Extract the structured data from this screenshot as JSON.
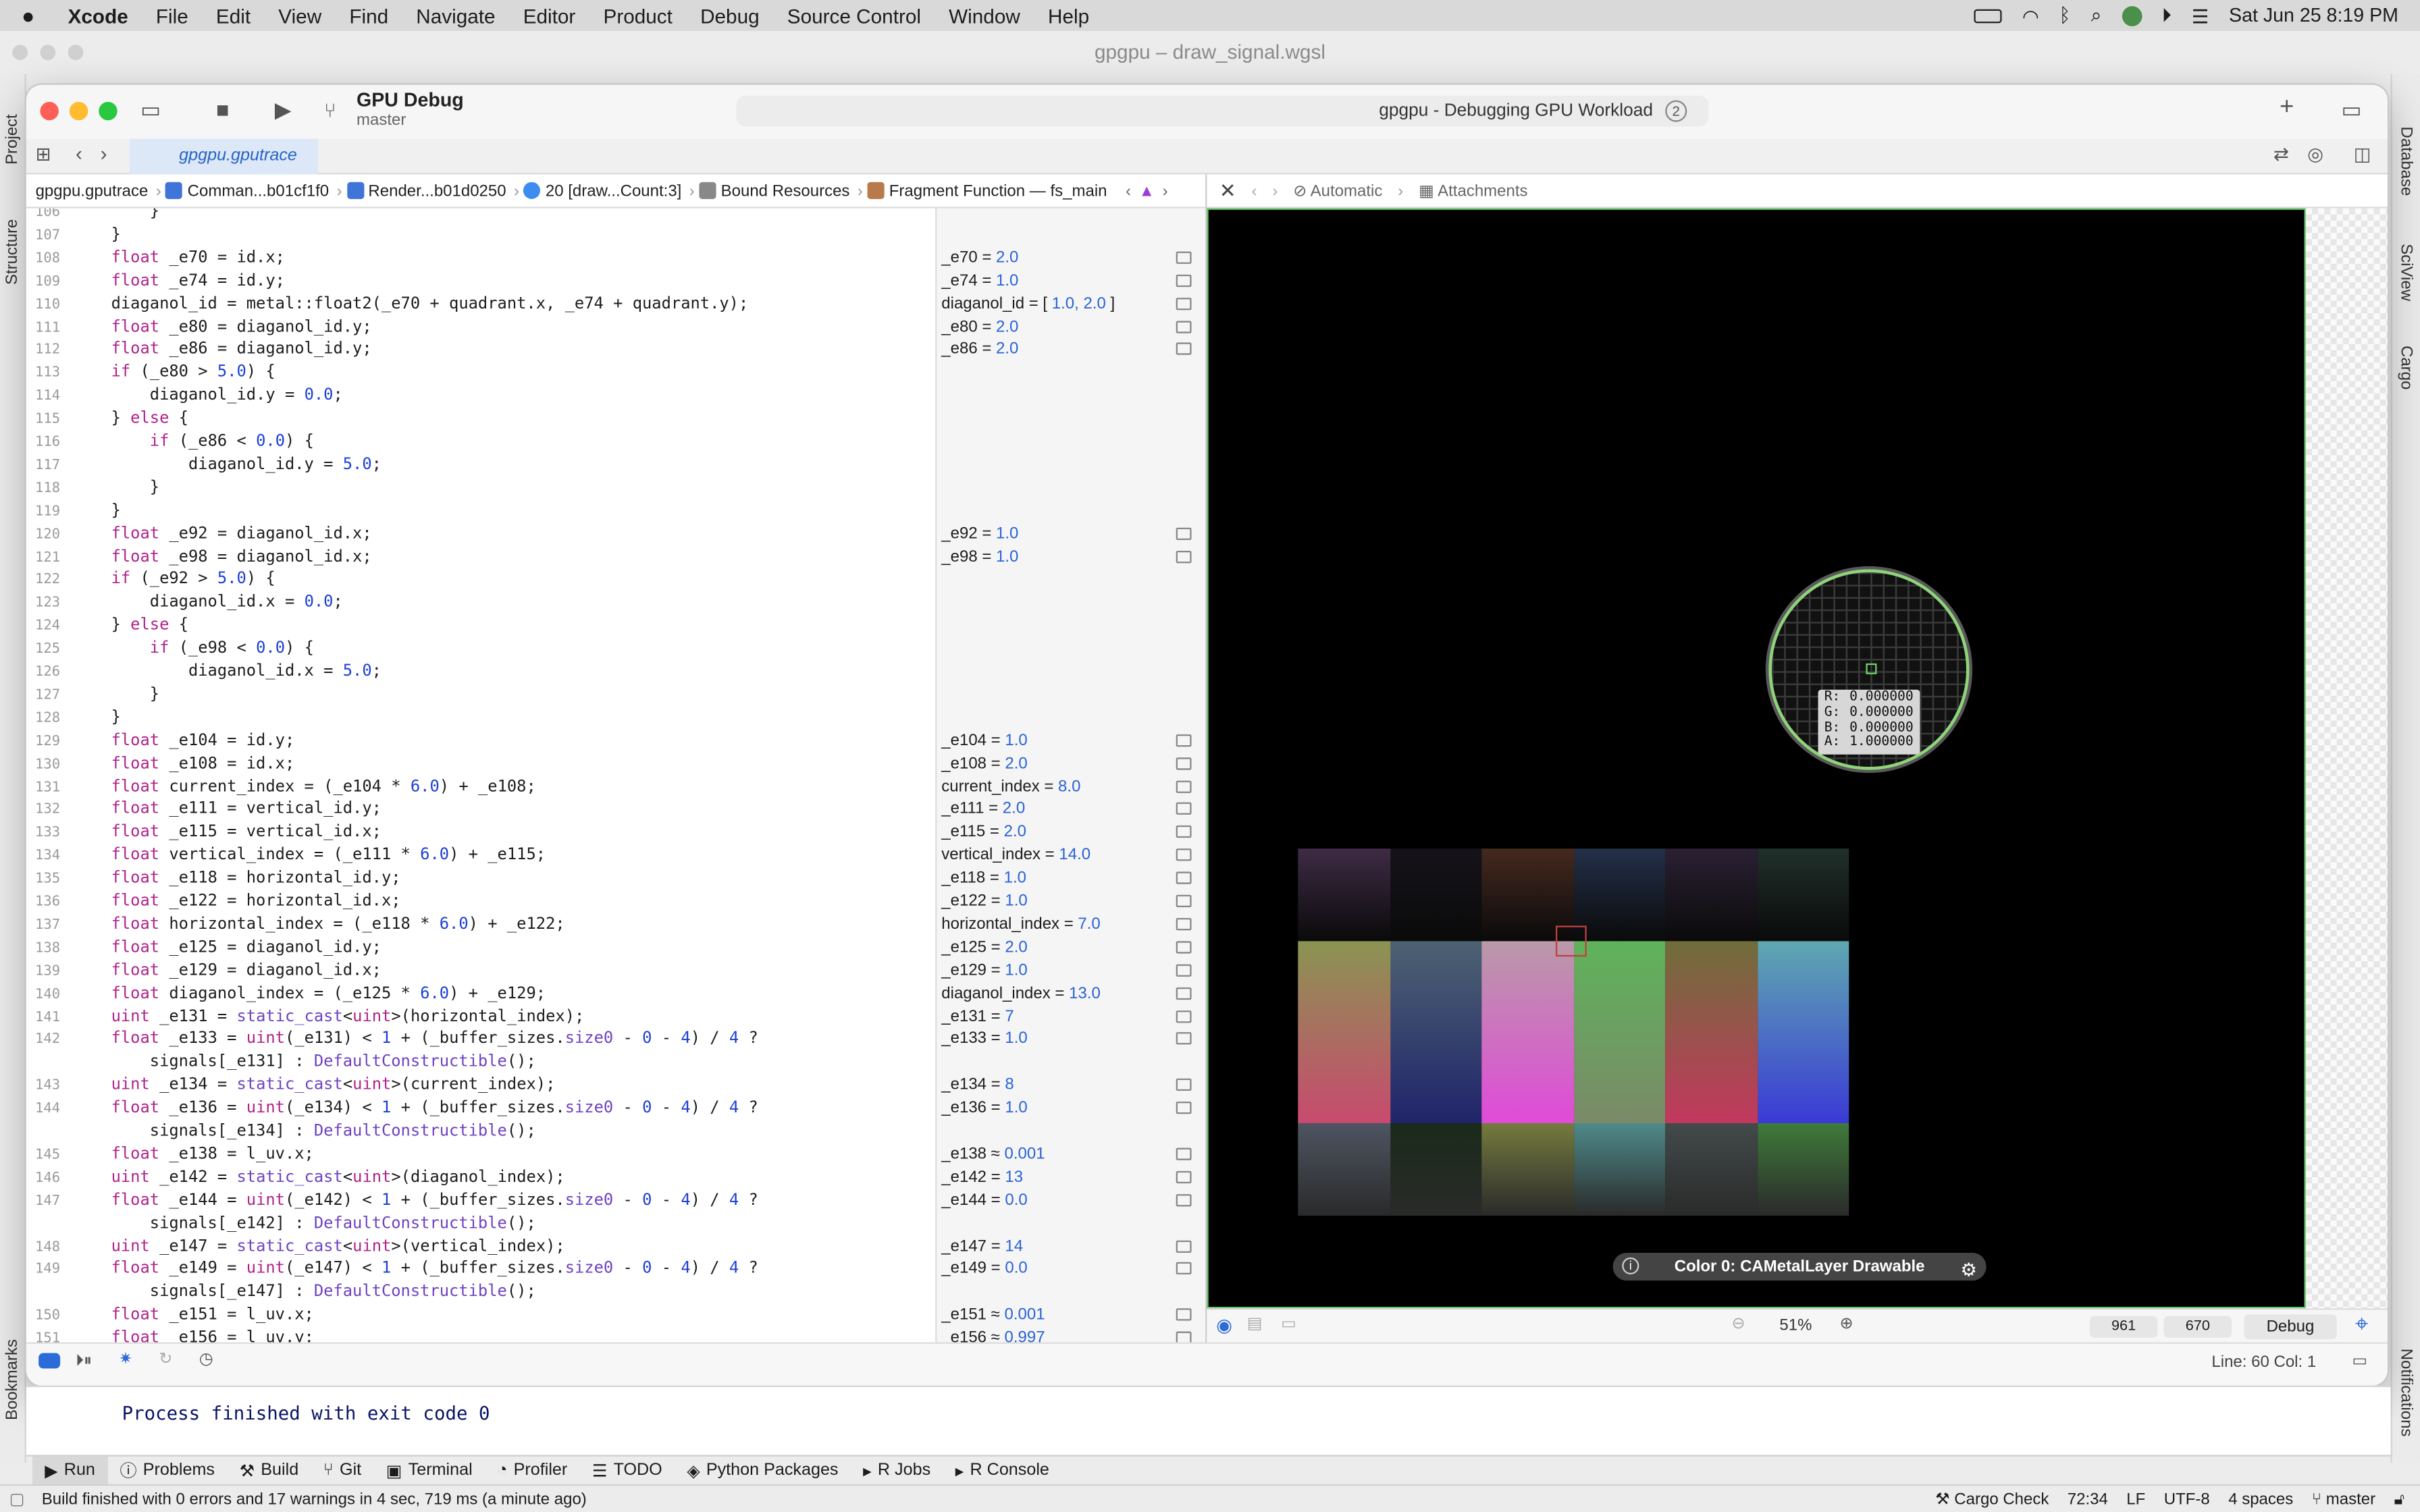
{
  "menubar": {
    "app": "Xcode",
    "items": [
      "File",
      "Edit",
      "View",
      "Find",
      "Navigate",
      "Editor",
      "Product",
      "Debug",
      "Source Control",
      "Window",
      "Help"
    ],
    "clock": "Sat Jun 25  8:19 PM"
  },
  "ide_title": "gpgpu – draw_signal.wgsl",
  "ide_left_tabs": [
    "Project",
    "Structure",
    "Bookmarks"
  ],
  "ide_right_tabs": [
    "Database",
    "SciView",
    "Cargo",
    "Notifications"
  ],
  "xcode": {
    "scheme_name": "GPU Debug",
    "scheme_branch": "master",
    "activity": "gpgpu - Debugging GPU Workload",
    "activity_badge": "2",
    "tab": "gpgpu.gputrace",
    "breadcrumbs": [
      "gpgpu.gputrace",
      "Comman...b01cf1f0",
      "Render...b01d0250",
      "20 [draw...Count:3]",
      "Bound Resources",
      "Fragment Function — fs_main"
    ],
    "right_crumbs": [
      "Automatic",
      "Attachments"
    ],
    "code_lines": [
      {
        "n": "106",
        "t": "    }"
      },
      {
        "n": "107",
        "t": "}"
      },
      {
        "n": "108",
        "t": "float _e70 = id.x;"
      },
      {
        "n": "109",
        "t": "float _e74 = id.y;"
      },
      {
        "n": "110",
        "t": "diaganol_id = metal::float2(_e70 + quadrant.x, _e74 + quadrant.y);"
      },
      {
        "n": "111",
        "t": "float _e80 = diaganol_id.y;"
      },
      {
        "n": "112",
        "t": "float _e86 = diaganol_id.y;"
      },
      {
        "n": "113",
        "t": "if (_e80 > 5.0) {"
      },
      {
        "n": "114",
        "t": "    diaganol_id.y = 0.0;"
      },
      {
        "n": "115",
        "t": "} else {"
      },
      {
        "n": "116",
        "t": "    if (_e86 < 0.0) {"
      },
      {
        "n": "117",
        "t": "        diaganol_id.y = 5.0;"
      },
      {
        "n": "118",
        "t": "    }"
      },
      {
        "n": "119",
        "t": "}"
      },
      {
        "n": "120",
        "t": "float _e92 = diaganol_id.x;"
      },
      {
        "n": "121",
        "t": "float _e98 = diaganol_id.x;"
      },
      {
        "n": "122",
        "t": "if (_e92 > 5.0) {"
      },
      {
        "n": "123",
        "t": "    diaganol_id.x = 0.0;"
      },
      {
        "n": "124",
        "t": "} else {"
      },
      {
        "n": "125",
        "t": "    if (_e98 < 0.0) {"
      },
      {
        "n": "126",
        "t": "        diaganol_id.x = 5.0;"
      },
      {
        "n": "127",
        "t": "    }"
      },
      {
        "n": "128",
        "t": "}"
      },
      {
        "n": "129",
        "t": "float _e104 = id.y;"
      },
      {
        "n": "130",
        "t": "float _e108 = id.x;"
      },
      {
        "n": "131",
        "t": "float current_index = (_e104 * 6.0) + _e108;"
      },
      {
        "n": "132",
        "t": "float _e111 = vertical_id.y;"
      },
      {
        "n": "133",
        "t": "float _e115 = vertical_id.x;"
      },
      {
        "n": "134",
        "t": "float vertical_index = (_e111 * 6.0) + _e115;"
      },
      {
        "n": "135",
        "t": "float _e118 = horizontal_id.y;"
      },
      {
        "n": "136",
        "t": "float _e122 = horizontal_id.x;"
      },
      {
        "n": "137",
        "t": "float horizontal_index = (_e118 * 6.0) + _e122;"
      },
      {
        "n": "138",
        "t": "float _e125 = diaganol_id.y;"
      },
      {
        "n": "139",
        "t": "float _e129 = diaganol_id.x;"
      },
      {
        "n": "140",
        "t": "float diaganol_index = (_e125 * 6.0) + _e129;"
      },
      {
        "n": "141",
        "t": "uint _e131 = static_cast<uint>(horizontal_index);"
      },
      {
        "n": "142",
        "t": "float _e133 = uint(_e131) < 1 + (_buffer_sizes.size0 - 0 - 4) / 4 ?"
      },
      {
        "n": "",
        "t": "    signals[_e131] : DefaultConstructible();"
      },
      {
        "n": "143",
        "t": "uint _e134 = static_cast<uint>(current_index);"
      },
      {
        "n": "144",
        "t": "float _e136 = uint(_e134) < 1 + (_buffer_sizes.size0 - 0 - 4) / 4 ?"
      },
      {
        "n": "",
        "t": "    signals[_e134] : DefaultConstructible();"
      },
      {
        "n": "145",
        "t": "float _e138 = l_uv.x;"
      },
      {
        "n": "146",
        "t": "uint _e142 = static_cast<uint>(diaganol_index);"
      },
      {
        "n": "147",
        "t": "float _e144 = uint(_e142) < 1 + (_buffer_sizes.size0 - 0 - 4) / 4 ?"
      },
      {
        "n": "",
        "t": "    signals[_e142] : DefaultConstructible();"
      },
      {
        "n": "148",
        "t": "uint _e147 = static_cast<uint>(vertical_index);"
      },
      {
        "n": "149",
        "t": "float _e149 = uint(_e147) < 1 + (_buffer_sizes.size0 - 0 - 4) / 4 ?"
      },
      {
        "n": "",
        "t": "    signals[_e147] : DefaultConstructible();"
      },
      {
        "n": "150",
        "t": "float _e151 = l_uv.x;"
      },
      {
        "n": "151",
        "t": "float _e156 = l_uv.y;"
      }
    ],
    "values": [
      {
        "row": 2,
        "label": "_e70 = ",
        "value": "2.0"
      },
      {
        "row": 3,
        "label": "_e74 = ",
        "value": "1.0"
      },
      {
        "row": 4,
        "label": "diaganol_id = [ ",
        "value": "1.0, 2.0",
        " suffix": " ]"
      },
      {
        "row": 5,
        "label": "_e80 = ",
        "value": "2.0"
      },
      {
        "row": 6,
        "label": "_e86 = ",
        "value": "2.0"
      },
      {
        "row": 14,
        "label": "_e92 = ",
        "value": "1.0"
      },
      {
        "row": 15,
        "label": "_e98 = ",
        "value": "1.0"
      },
      {
        "row": 23,
        "label": "_e104 = ",
        "value": "1.0"
      },
      {
        "row": 24,
        "label": "_e108 = ",
        "value": "2.0"
      },
      {
        "row": 25,
        "label": "current_index = ",
        "value": "8.0"
      },
      {
        "row": 26,
        "label": "_e111 = ",
        "value": "2.0"
      },
      {
        "row": 27,
        "label": "_e115 = ",
        "value": "2.0"
      },
      {
        "row": 28,
        "label": "vertical_index = ",
        "value": "14.0"
      },
      {
        "row": 29,
        "label": "_e118 = ",
        "value": "1.0"
      },
      {
        "row": 30,
        "label": "_e122 = ",
        "value": "1.0"
      },
      {
        "row": 31,
        "label": "horizontal_index = ",
        "value": "7.0"
      },
      {
        "row": 32,
        "label": "_e125 = ",
        "value": "2.0"
      },
      {
        "row": 33,
        "label": "_e129 = ",
        "value": "1.0"
      },
      {
        "row": 34,
        "label": "diaganol_index = ",
        "value": "13.0"
      },
      {
        "row": 35,
        "label": "_e131 = ",
        "value": "7"
      },
      {
        "row": 36,
        "label": "_e133 = ",
        "value": "1.0"
      },
      {
        "row": 38,
        "label": "_e134 = ",
        "value": "8"
      },
      {
        "row": 39,
        "label": "_e136 = ",
        "value": "1.0"
      },
      {
        "row": 41,
        "label": "_e138 ≈ ",
        "value": "0.001"
      },
      {
        "row": 42,
        "label": "_e142 = ",
        "value": "13"
      },
      {
        "row": 43,
        "label": "_e144 = ",
        "value": "0.0"
      },
      {
        "row": 45,
        "label": "_e147 = ",
        "value": "14"
      },
      {
        "row": 46,
        "label": "_e149 = ",
        "value": "0.0"
      },
      {
        "row": 48,
        "label": "_e151 ≈ ",
        "value": "0.001"
      },
      {
        "row": 49,
        "label": "_e156 ≈ ",
        "value": "0.997"
      }
    ],
    "pixel_rgba": [
      {
        "k": "R:",
        "v": "0.000000"
      },
      {
        "k": "G:",
        "v": "0.000000"
      },
      {
        "k": "B:",
        "v": "0.000000"
      },
      {
        "k": "A:",
        "v": "1.000000"
      }
    ],
    "attachment_label": "Color 0: CAMetalLayer Drawable",
    "zoom": "51%",
    "coord_x": "961",
    "coord_y": "670",
    "mode": "Debug",
    "cursor_pos": "Line: 60  Col: 1",
    "tile_colors": [
      "#3e2b45",
      "#151319",
      "#45291f",
      "#233049",
      "#2a2033",
      "#20302b",
      "#8a9452",
      "#4d6272",
      "#b99aa8",
      "#5fb35a",
      "#6f6d3a",
      "#5fa8b0",
      "#4e5562",
      "#1a2a1a",
      "#757b3e",
      "#4f8a8a",
      "#434a4a",
      "#3f7a3a"
    ]
  },
  "console_text": "Process finished with exit code 0",
  "tool_tabs": [
    "Run",
    "Problems",
    "Build",
    "Git",
    "Terminal",
    "Profiler",
    "TODO",
    "Python Packages",
    "R Jobs",
    "R Console"
  ],
  "status": {
    "left": "Build finished with 0 errors and 17 warnings in 4 sec, 719 ms (a minute ago)",
    "right": [
      "Cargo Check",
      "72:34",
      "LF",
      "UTF-8",
      "4 spaces",
      "master"
    ]
  }
}
